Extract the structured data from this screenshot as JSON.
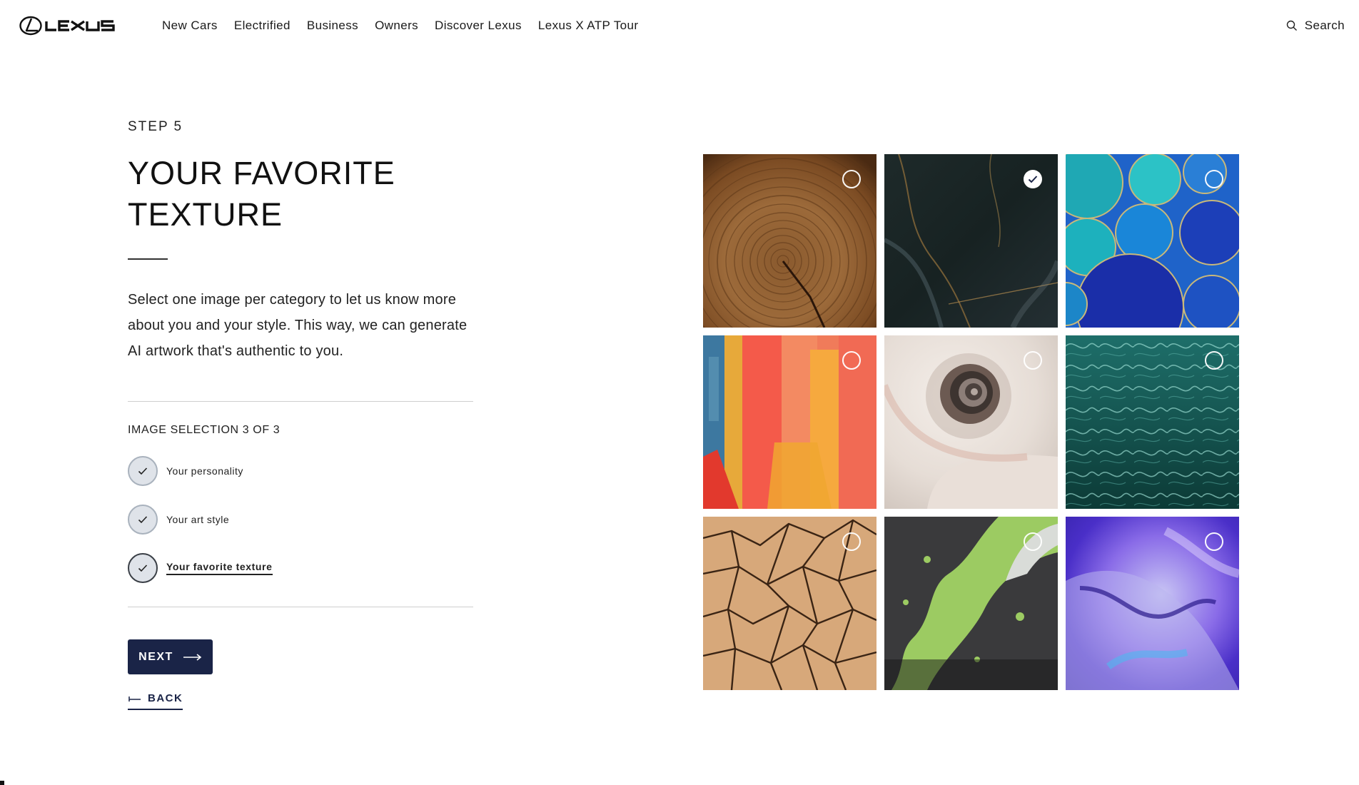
{
  "header": {
    "brand": "LEXUS",
    "nav": [
      "New Cars",
      "Electrified",
      "Business",
      "Owners",
      "Discover Lexus",
      "Lexus X ATP Tour"
    ],
    "search_label": "Search"
  },
  "content": {
    "step_label": "STEP 5",
    "title": "YOUR FAVORITE TEXTURE",
    "description": "Select one image per category to let us know more about you and your style. This way, we can generate AI artwork that's authentic to you.",
    "selection_heading": "IMAGE SELECTION 3 OF 3",
    "checklist": [
      {
        "label": "Your personality",
        "checked": true
      },
      {
        "label": "Your art style",
        "checked": true
      },
      {
        "label": "Your favorite texture",
        "checked": true,
        "active": true
      }
    ],
    "next_label": "NEXT",
    "back_label": "BACK"
  },
  "grid": {
    "tiles": [
      {
        "name": "wood-rings",
        "selected": false
      },
      {
        "name": "dark-marble",
        "selected": true
      },
      {
        "name": "blue-bubbles",
        "selected": false
      },
      {
        "name": "paint-strokes",
        "selected": false
      },
      {
        "name": "seashell",
        "selected": false
      },
      {
        "name": "water-ripples",
        "selected": false
      },
      {
        "name": "cracked-earth",
        "selected": false
      },
      {
        "name": "green-splatter",
        "selected": false
      },
      {
        "name": "purple-ink",
        "selected": false
      }
    ]
  },
  "colors": {
    "primary": "#1a2447",
    "check_bg": "#dfe3e9"
  }
}
